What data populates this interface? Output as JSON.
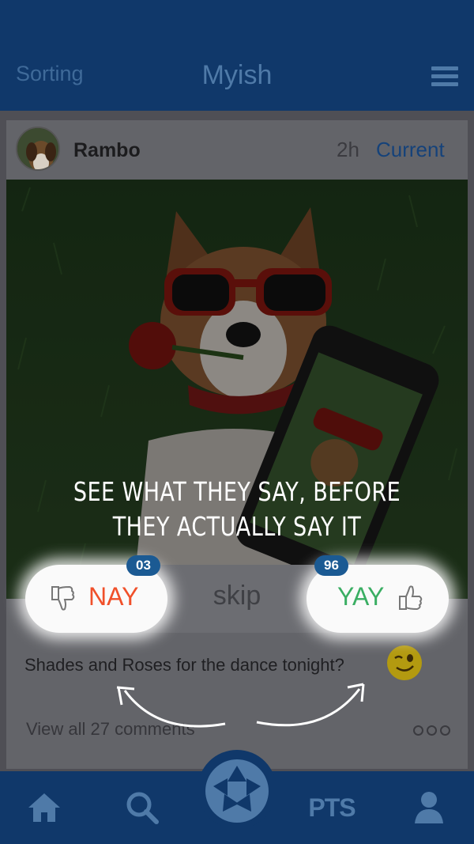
{
  "header": {
    "left_label": "Sorting",
    "title": "Myish",
    "menu_icon": "hamburger-menu-icon"
  },
  "post": {
    "username": "Rambo",
    "time": "2h",
    "status": "Current",
    "caption": "Shades and Roses for the dance tonight?",
    "comments_link": "View all 27 comments",
    "more_icon": "more-dots-icon"
  },
  "overlay": {
    "line1": "SEE WHAT THEY SAY, BEFORE",
    "line2": "THEY ACTUALLY SAY IT"
  },
  "vote": {
    "nay_label": "NAY",
    "nay_count": "03",
    "skip_label": "skip",
    "yay_label": "YAY",
    "yay_count": "96"
  },
  "tabbar": {
    "pts_label": "PTS"
  },
  "colors": {
    "nay": "#f0502a",
    "yay": "#3aae63",
    "brand": "#10386a",
    "badge": "#1b5a93"
  }
}
